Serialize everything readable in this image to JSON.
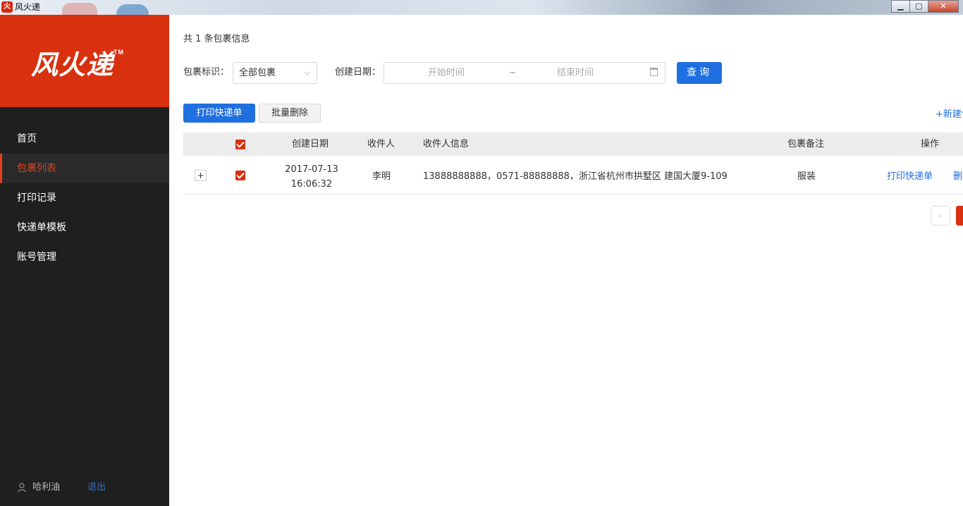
{
  "window": {
    "title": "风火递",
    "app_icon_glyph": "火",
    "minimize": "▁",
    "maximize": "▢",
    "close": "✕"
  },
  "sidebar": {
    "logo_text": "风火递",
    "logo_tm": "TM",
    "items": [
      {
        "label": "首页"
      },
      {
        "label": "包裹列表"
      },
      {
        "label": "打印记录"
      },
      {
        "label": "快递单模板"
      },
      {
        "label": "账号管理"
      }
    ],
    "user_name": "哈利油",
    "logout_label": "退出"
  },
  "main": {
    "count_text": "共 1 条包裹信息",
    "filters": {
      "tag_label": "包裹标识：",
      "tag_value": "全部包裹",
      "date_label": "创建日期：",
      "start_placeholder": "开始时间",
      "separator": "~",
      "end_placeholder": "结束时间",
      "query_label": "查询"
    },
    "actions": {
      "print_label": "打印快递单",
      "batch_delete_label": "批量删除",
      "new_label": "+新建包裹"
    },
    "table": {
      "headers": {
        "created_date": "创建日期",
        "recipient": "收件人",
        "recipient_info": "收件人信息",
        "remark": "包裹备注",
        "operations": "操作"
      },
      "rows": [
        {
          "expand": "+",
          "date": "2017-07-13",
          "time": "16:06:32",
          "recipient": "李明",
          "info": "13888888888，0571-88888888，浙江省杭州市拱墅区 建国大厦9-109",
          "remark": "服装",
          "op_print": "打印快递单",
          "op_delete": "删除"
        }
      ]
    },
    "pager_prev": "‹"
  }
}
